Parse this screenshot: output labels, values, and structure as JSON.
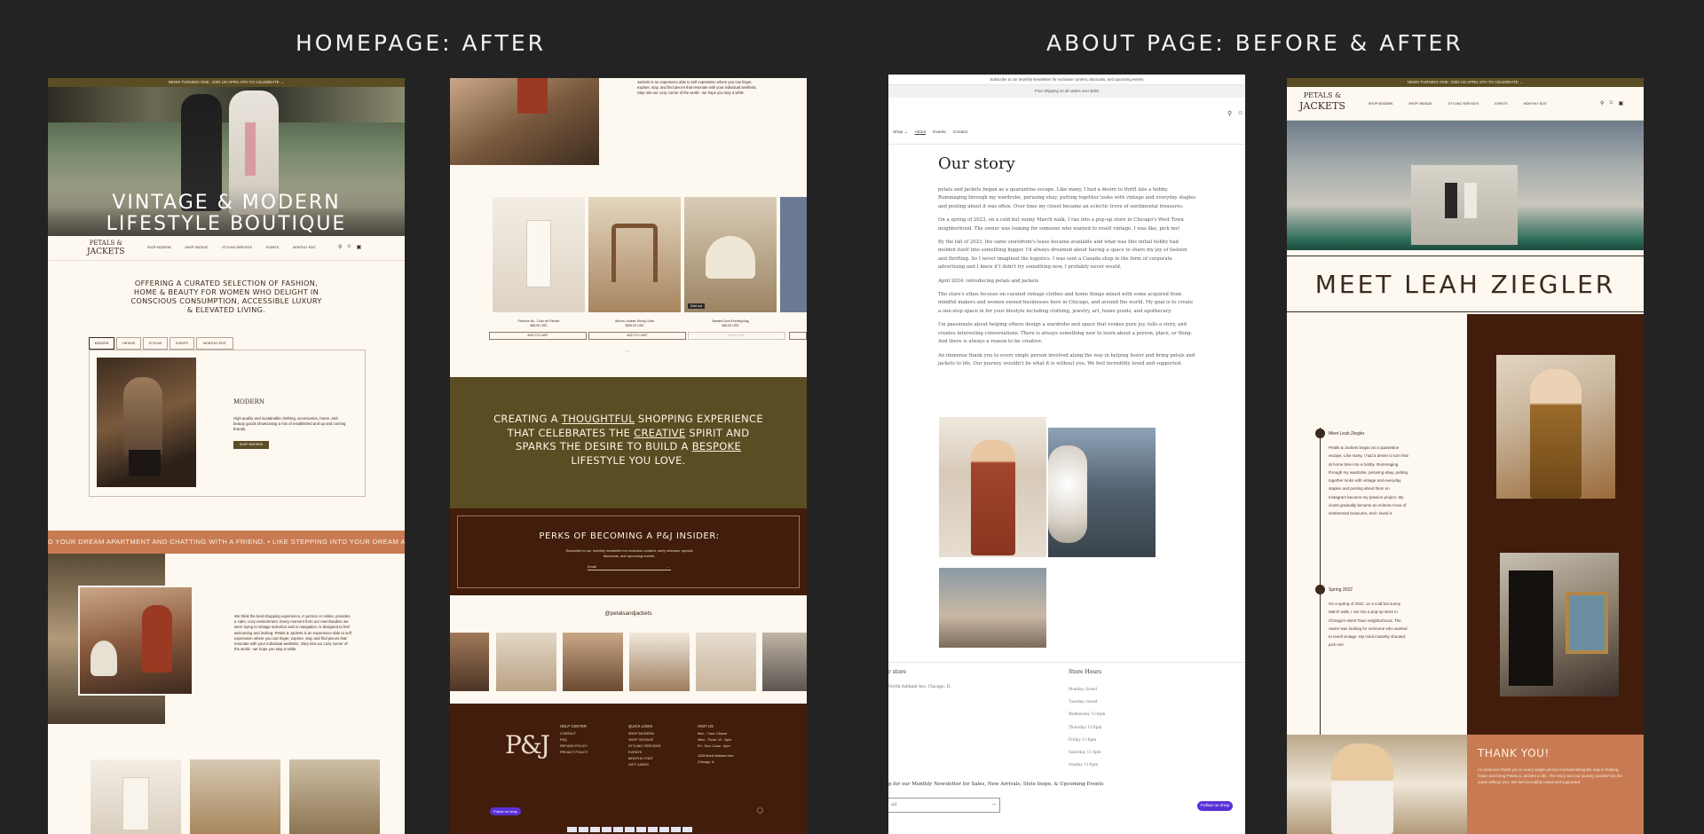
{
  "headings": {
    "left": "HOMEPAGE: AFTER",
    "right": "ABOUT PAGE: BEFORE & AFTER"
  },
  "colors": {
    "page_bg": "#232323",
    "cream": "#fdf8f0",
    "olive": "#5b4d23",
    "brown": "#421d0b",
    "terracotta": "#c87b52"
  },
  "home1": {
    "announcement": "NEWS TURNING ONE: JOIN US APRIL 5TH TO CELEBRATE →",
    "hero_title_line1": "VINTAGE & MODERN",
    "hero_title_line2": "LIFESTYLE BOUTIQUE",
    "logo_line1": "PETALS &",
    "logo_line2": "JACKETS",
    "nav": [
      "SHOP MODERN",
      "SHOP VINTAGE",
      "STYLING SERVICES",
      "EVENTS",
      "MONTHLY EDIT"
    ],
    "tagline": "OFFERING A CURATED SELECTION OF FASHION, HOME & BEAUTY FOR WOMEN WHO DELIGHT IN CONSCIOUS CONSUMPTION, ACCESSIBLE LUXURY & ELEVATED LIVING.",
    "tabs": [
      "MODERN",
      "VINTAGE",
      "STYLING",
      "EVENTS",
      "MONTHLY EDIT"
    ],
    "card_title": "MODERN",
    "card_text": "High quality and sustainable clothing, accessories, home, and beauty goods showcasing a mix of established and up and coming brands.",
    "card_button": "SHOP MODERN",
    "marquee": "D YOUR DREAM APARTMENT AND CHATTING WITH A FRIEND.   •   LIKE STEPPING INTO YOUR DREAM APARTMENT AND",
    "about_text": "We think the best shopping experience, in person or online, provides a calm, cozy environment. Every moment from our merchandise we were trying to vintage selection and to navigation, is designed to feel welcoming and inviting. Petals & Jackets is an experience able to self expression where you can linger, explore, stay and find pieces that resonate with your individual aesthetic. Step into our cozy corner of the world - we hope you stay a while."
  },
  "home2": {
    "about_text": "Jackets is an experience able to self expression where you can linger, explore, stay, and find pieces that resonate with your individual aesthetic. Step into our cozy corner of the world - we hope you stay a while.",
    "products": [
      {
        "name": "Perfume No. 1 Eau de Parfum",
        "price": "$68.00 USD",
        "button": "ADD TO CART"
      },
      {
        "name": "Woven Leather Dining Chair",
        "price": "$285.00 USD",
        "button": "ADD TO CART"
      },
      {
        "name": "Beaded Gold Evening Bag",
        "price": "$45.00 USD",
        "button": "SOLD OUT",
        "badge": "Sold out"
      }
    ],
    "mission_pre1": "CREATING A ",
    "mission_u1": "THOUGHTFUL",
    "mission_post1": " SHOPPING EXPERIENCE",
    "mission_pre2": "THAT CELEBRATES THE ",
    "mission_u2": "CREATIVE",
    "mission_post2": " SPIRIT AND",
    "mission_pre3": "SPARKS THE DESIRE TO BUILD A ",
    "mission_u3": "BESPOKE",
    "mission_line4": "LIFESTYLE YOU LOVE.",
    "perks_title": "PERKS OF BECOMING A P&J INSIDER:",
    "perks_text": "Subscribe to our monthly newsletter for exclusive content, early releases, special discounts, and upcoming events.",
    "email_placeholder": "Email",
    "instagram_handle": "@petalsandjackets",
    "footer_monogram": "P&J",
    "footer_cols": [
      {
        "title": "HELP CENTER",
        "items": [
          "CONTACT",
          "FAQ",
          "REFUND POLICY",
          "PRIVACY POLICY"
        ]
      },
      {
        "title": "QUICK LINKS",
        "items": [
          "SHOP MODERN",
          "SHOP VINTAGE",
          "STYLING SERVICES",
          "EVENTS",
          "MONTHLY EDIT",
          "GIFT CARDS"
        ]
      },
      {
        "title": "VISIT US",
        "items": [
          "Mon - Tues: Closed",
          "Wed - Thurs: 12 - 6pm",
          "Fri - Sun: 11am - 6pm",
          "",
          "1528 North Ashland Ave",
          "Chicago, IL"
        ]
      }
    ],
    "follow_shop": "Follow on shop"
  },
  "before": {
    "announcement": "Subscribe to our Monthly Newsletter for exclusive content, discounts, and upcoming events",
    "shipping_bar": "Free Shipping on all orders over $150",
    "nav": [
      "Shop",
      "About",
      "Events",
      "Contact"
    ],
    "title": "Our story",
    "paragraphs": [
      "petals and jackets began as a quarantine escape. Like many, I had a desire to thrift late a hobby. Rummaging through my wardrobe, perusing ebay, putting together looks with vintage and everyday staples and posting about it was often. Over time my closet became an eclectic trove of sentimental treasures.",
      "On a spring of 2023, on a cold but sunny March walk, I ran into a pop-up store in Chicago's West Town neighborhood. The owner was looking for someone who wanted to resell vintage. I was like, pick me!",
      "By the fall of 2023, the same storefront's lease became available and what was this initial hobby had molded itself into something bigger. I'd always dreamed about having a space to share my joy of fashion and thrifting. So I never imagined the logistics. I was sent a Canada shop in the form of corporate advertising and I knew if I didn't try something now, I probably never would.",
      "April 2024: introducing petals and jackets",
      "The store's ethos focuses on curated vintage clothes and home things mixed with some acquired from mindful makers and women owned businesses here in Chicago, and around the world. My goal is to create a one-stop space in for your lifestyle including clothing, jewelry, art, home goods, and apothecary.",
      "I'm passionate about helping others design a wardrobe and space that evokes pure joy, tells a story, and creates interesting conversations. There is always something new to learn about a person, place, or thing. And there is always a reason to be creative.",
      "An immense thank you to every single person involved along the way in helping foster and bring petals and jackets to life. Our journey wouldn't be what it is without you. We feel incredibly loved and supported."
    ],
    "footer_left_title": "r store",
    "footer_left_text": "North Ashland Ave, Chicago, IL",
    "hours_title": "Store Hours",
    "hours": [
      "Monday closed",
      "Tuesday closed",
      "Wednesday 12-6pm",
      "Thursday 12-6pm",
      "Friday 11-6pm",
      "Saturday 11-6pm",
      "Sunday 11-6pm"
    ],
    "newsletter": "p for our Monthly Newsletter for Sales, New Arrivals, Style Inspo, & Upcoming Events",
    "email_placeholder": "ail",
    "follow_shop": "Follow on shop"
  },
  "after": {
    "announcement": "NEWS TURNING ONE: JOIN US APRIL 5TH TO CELEBRATE →",
    "logo_line1": "PETALS &",
    "logo_line2": "JACKETS",
    "nav": [
      "SHOP MODERN",
      "SHOP VINTAGE",
      "STYLING SERVICES",
      "EVENTS",
      "MONTHLY EDIT"
    ],
    "title": "MEET LEAH ZIEGLER",
    "timeline": [
      {
        "title": "Meet Leah Ziegler",
        "text": "Petals & Jackets began as a quarantine escape. Like many, I had a desire to turn that at home time into a hobby. Rummaging through my wardrobe, perusing ebay, putting together looks with vintage and everyday staples and posting about them on Instagram became my passion project. My closet gradually became an eclectic trove of sentimental treasures, and I loved it."
      },
      {
        "title": "Spring 2022",
        "text": "On a spring of 2022, on a cold but sunny March walk, I ran into a pop-up store in Chicago's West Town neighborhood. The owner was looking for someone who wanted to resell vintage. My mind instantly shouted, pick me!"
      }
    ],
    "thanks_title": "THANK YOU!",
    "thanks_text": "An immense thank you to every single person involved along the way in helping foster and bring Petals & Jackets to life. The story and our journey wouldn't be the same without you. We feel incredibly loved and supported."
  }
}
